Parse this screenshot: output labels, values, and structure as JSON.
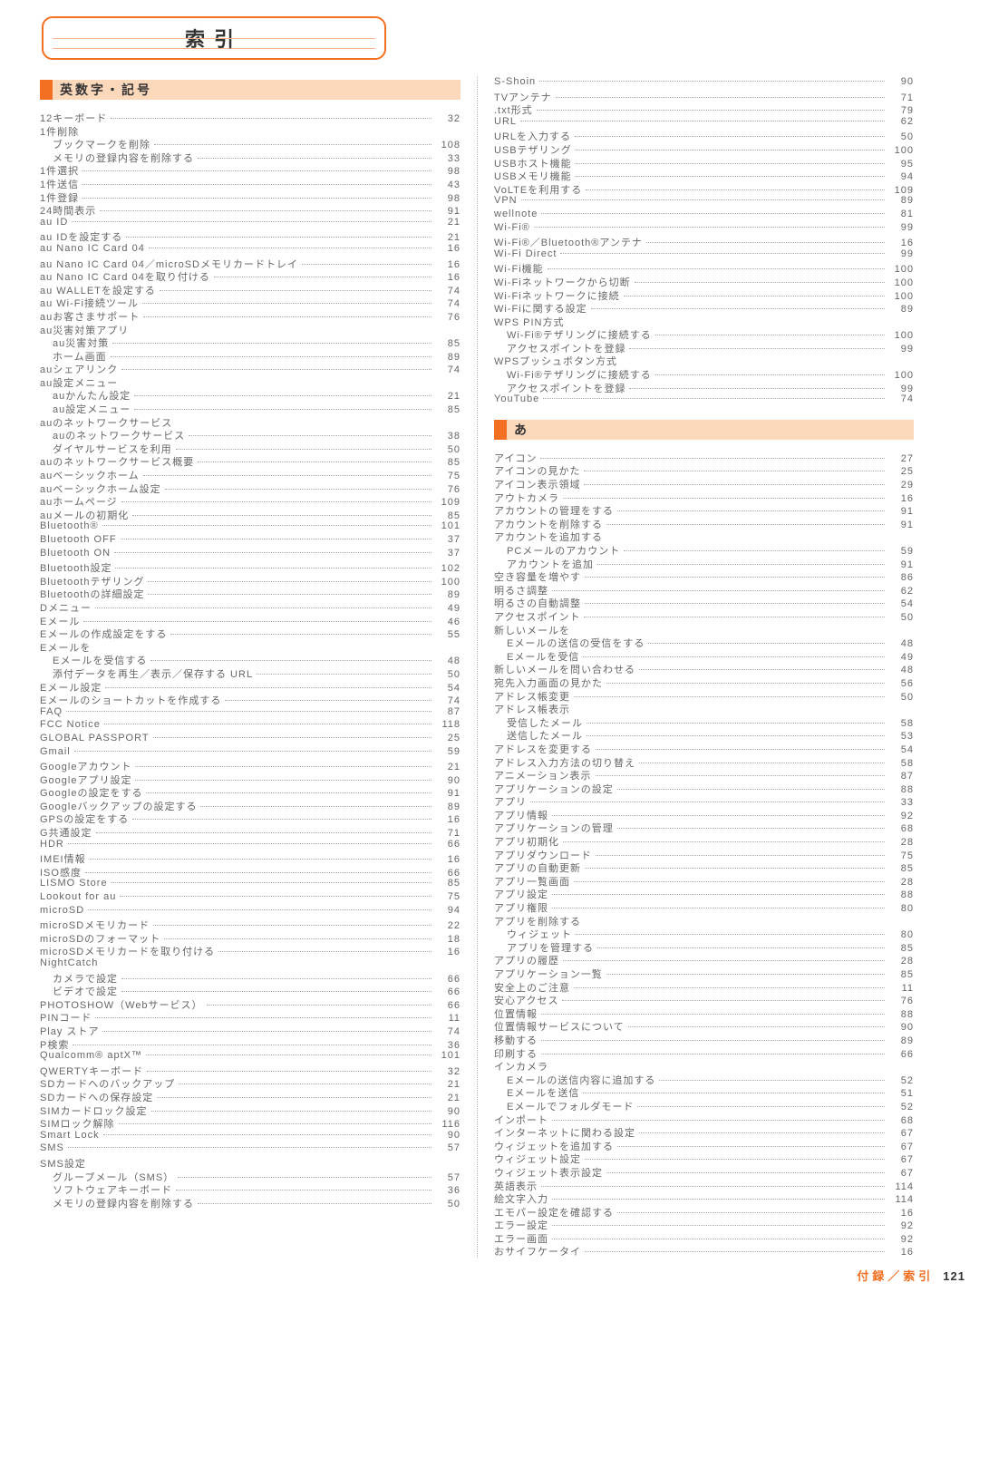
{
  "title": "索引",
  "sections": {
    "alpha": "英数字・記号",
    "kana": "あ"
  },
  "footer": {
    "label": "付録／索引",
    "page": "121"
  },
  "col1": [
    {
      "t": "12キーボード",
      "p": 32
    },
    {
      "t": "1件削除",
      "head": true
    },
    {
      "t": "ブックマークを削除",
      "p": 108,
      "i": 1
    },
    {
      "t": "メモリの登録内容を削除する",
      "p": 33,
      "i": 1
    },
    {
      "t": "1件選択",
      "p": 98
    },
    {
      "t": "1件送信",
      "p": 43
    },
    {
      "t": "1件登録",
      "p": 98
    },
    {
      "t": "24時間表示",
      "p": 91
    },
    {
      "t": "au ID",
      "p": 21
    },
    {
      "t": "au IDを設定する",
      "p": 21
    },
    {
      "t": "au Nano IC Card 04",
      "p": 16
    },
    {
      "t": "au Nano IC Card 04／microSDメモリカードトレイ",
      "p": 16
    },
    {
      "t": "au Nano IC Card 04を取り付ける",
      "p": 16
    },
    {
      "t": "au WALLETを設定する",
      "p": 74
    },
    {
      "t": "au Wi-Fi接続ツール",
      "p": 74
    },
    {
      "t": "auお客さまサポート",
      "p": 76
    },
    {
      "t": "au災害対策アプリ",
      "head": true
    },
    {
      "t": "au災害対策",
      "p": 85,
      "i": 1
    },
    {
      "t": "ホーム画面",
      "p": 89,
      "i": 1
    },
    {
      "t": "auシェアリンク",
      "p": 74
    },
    {
      "t": "au設定メニュー",
      "head": true
    },
    {
      "t": "auかんたん設定",
      "p": 21,
      "i": 1
    },
    {
      "t": "au設定メニュー",
      "p": 85,
      "i": 1
    },
    {
      "t": "auのネットワークサービス",
      "head": true
    },
    {
      "t": "auのネットワークサービス",
      "p": 38,
      "i": 1
    },
    {
      "t": "ダイヤルサービスを利用",
      "p": 50,
      "i": 1
    },
    {
      "t": "auのネットワークサービス概要",
      "p": 85
    },
    {
      "t": "auベーシックホーム",
      "p": 75
    },
    {
      "t": "auベーシックホーム設定",
      "p": 76
    },
    {
      "t": "auホームページ",
      "p": 109
    },
    {
      "t": "auメールの初期化",
      "p": 85
    },
    {
      "t": "Bluetooth®",
      "p": 101
    },
    {
      "t": "Bluetooth OFF",
      "p": 37
    },
    {
      "t": "Bluetooth ON",
      "p": 37
    },
    {
      "t": "Bluetooth設定",
      "p": 102
    },
    {
      "t": "Bluetoothテザリング",
      "p": 100
    },
    {
      "t": "Bluetoothの詳細設定",
      "p": 89
    },
    {
      "t": "Dメニュー",
      "p": 49
    },
    {
      "t": "Eメール",
      "p": 46
    },
    {
      "t": "Eメールの作成設定をする",
      "p": 55
    },
    {
      "t": "Eメールを",
      "head": true
    },
    {
      "t": "Eメールを受信する",
      "p": 48,
      "i": 1
    },
    {
      "t": "添付データを再生／表示／保存する URL",
      "p": 50,
      "i": 1
    },
    {
      "t": "Eメール設定",
      "p": 54
    },
    {
      "t": "Eメールのショートカットを作成する",
      "p": 74
    },
    {
      "t": "FAQ",
      "p": 87
    },
    {
      "t": "FCC Notice",
      "p": 118
    },
    {
      "t": "GLOBAL PASSPORT",
      "p": 25
    },
    {
      "t": "Gmail",
      "p": 59
    },
    {
      "t": "Googleアカウント",
      "p": 21
    },
    {
      "t": "Googleアプリ設定",
      "p": 90
    },
    {
      "t": "Googleの設定をする",
      "p": 91
    },
    {
      "t": "Googleバックアップの設定する",
      "p": 89
    },
    {
      "t": "GPSの設定をする",
      "p": 16
    },
    {
      "t": "G共通設定",
      "p": 71
    },
    {
      "t": "HDR",
      "p": 66
    },
    {
      "t": "IMEI情報",
      "p": 16
    },
    {
      "t": "ISO感度",
      "p": 66
    },
    {
      "t": "LISMO Store",
      "p": 85
    },
    {
      "t": "Lookout for au",
      "p": 75
    },
    {
      "t": "microSD",
      "p": 94
    },
    {
      "t": "microSDメモリカード",
      "p": 22
    },
    {
      "t": "microSDのフォーマット",
      "p": 18
    },
    {
      "t": "microSDメモリカードを取り付ける",
      "p": 16
    },
    {
      "t": "NightCatch",
      "head": true
    },
    {
      "t": "カメラで設定",
      "p": 66,
      "i": 1
    },
    {
      "t": "ビデオで設定",
      "p": 66,
      "i": 1
    },
    {
      "t": "PHOTOSHOW（Webサービス）",
      "p": 66
    },
    {
      "t": "PINコード",
      "p": 11
    },
    {
      "t": "Play ストア",
      "p": 74
    },
    {
      "t": "P検索",
      "p": 36
    },
    {
      "t": "Qualcomm® aptX™",
      "p": 101
    },
    {
      "t": "QWERTYキーボード",
      "p": 32
    },
    {
      "t": "SDカードへのバックアップ",
      "p": 21
    },
    {
      "t": "SDカードへの保存設定",
      "p": 21
    },
    {
      "t": "SIMカードロック設定",
      "p": 90
    },
    {
      "t": "SIMロック解除",
      "p": 116
    },
    {
      "t": "Smart Lock",
      "p": 90
    },
    {
      "t": "SMS",
      "p": 57
    },
    {
      "t": "SMS設定",
      "head": true
    },
    {
      "t": "グループメール（SMS）",
      "p": 57,
      "i": 1
    },
    {
      "t": "ソフトウェアキーボード",
      "p": 36,
      "i": 1
    },
    {
      "t": "メモリの登録内容を削除する",
      "p": 50,
      "i": 1
    }
  ],
  "col2a": [
    {
      "t": "S-Shoin",
      "p": 90
    },
    {
      "t": "TVアンテナ",
      "p": 71
    },
    {
      "t": ".txt形式",
      "p": 79
    },
    {
      "t": "URL",
      "p": 62
    },
    {
      "t": "URLを入力する",
      "p": 50
    },
    {
      "t": "USBテザリング",
      "p": 100
    },
    {
      "t": "USBホスト機能",
      "p": 95
    },
    {
      "t": "USBメモリ機能",
      "p": 94
    },
    {
      "t": "VoLTEを利用する",
      "p": 109
    },
    {
      "t": "VPN",
      "p": 89
    },
    {
      "t": "wellnote",
      "p": 81
    },
    {
      "t": "Wi-Fi®",
      "p": 99
    },
    {
      "t": "Wi-Fi®／Bluetooth®アンテナ",
      "p": 16
    },
    {
      "t": "Wi-Fi Direct",
      "p": 99
    },
    {
      "t": "Wi-Fi機能",
      "p": 100
    },
    {
      "t": "Wi-Fiネットワークから切断",
      "p": 100
    },
    {
      "t": "Wi-Fiネットワークに接続",
      "p": 100
    },
    {
      "t": "Wi-Fiに関する設定",
      "p": 89
    },
    {
      "t": "WPS PIN方式",
      "head": true
    },
    {
      "t": "Wi-Fi®テザリングに接続する",
      "p": 100,
      "i": 1
    },
    {
      "t": "アクセスポイントを登録",
      "p": 99,
      "i": 1
    },
    {
      "t": "WPSプッシュボタン方式",
      "head": true
    },
    {
      "t": "Wi-Fi®テザリングに接続する",
      "p": 100,
      "i": 1
    },
    {
      "t": "アクセスポイントを登録",
      "p": 99,
      "i": 1
    },
    {
      "t": "YouTube",
      "p": 74
    }
  ],
  "col2b": [
    {
      "t": "アイコン",
      "p": 27
    },
    {
      "t": "アイコンの見かた",
      "p": 25
    },
    {
      "t": "アイコン表示領域",
      "p": 29
    },
    {
      "t": "アウトカメラ",
      "p": 16
    },
    {
      "t": "アカウントの管理をする",
      "p": 91
    },
    {
      "t": "アカウントを削除する",
      "p": 91
    },
    {
      "t": "アカウントを追加する",
      "head": true
    },
    {
      "t": "PCメールのアカウント",
      "p": 59,
      "i": 1
    },
    {
      "t": "アカウントを追加",
      "p": 91,
      "i": 1
    },
    {
      "t": "空き容量を増やす",
      "p": 86
    },
    {
      "t": "明るさ調整",
      "p": 62
    },
    {
      "t": "明るさの自動調整",
      "p": 54
    },
    {
      "t": "アクセスポイント",
      "p": 50
    },
    {
      "t": "新しいメールを",
      "head": true
    },
    {
      "t": "Eメールの送信の受信をする",
      "p": 48,
      "i": 1
    },
    {
      "t": "Eメールを受信",
      "p": 49,
      "i": 1
    },
    {
      "t": "新しいメールを問い合わせる",
      "p": 48
    },
    {
      "t": "宛先入力画面の見かた",
      "p": 56
    },
    {
      "t": "アドレス帳変更",
      "p": 50
    },
    {
      "t": "アドレス帳表示",
      "head": true
    },
    {
      "t": "受信したメール",
      "p": 58,
      "i": 1
    },
    {
      "t": "送信したメール",
      "p": 53,
      "i": 1
    },
    {
      "t": "アドレスを変更する",
      "p": 54
    },
    {
      "t": "アドレス入力方法の切り替え",
      "p": 58
    },
    {
      "t": "アニメーション表示",
      "p": 87
    },
    {
      "t": "アプリケーションの設定",
      "p": 88
    },
    {
      "t": "アプリ",
      "p": 33
    },
    {
      "t": "アプリ情報",
      "p": 92
    },
    {
      "t": "アプリケーションの管理",
      "p": 68
    },
    {
      "t": "アプリ初期化",
      "p": 28
    },
    {
      "t": "アプリダウンロード",
      "p": 75
    },
    {
      "t": "アプリの自動更新",
      "p": 85
    },
    {
      "t": "アプリ一覧画面",
      "p": 28
    },
    {
      "t": "アプリ設定",
      "p": 88
    },
    {
      "t": "アプリ権限",
      "p": 80
    },
    {
      "t": "アプリを削除する",
      "head": true
    },
    {
      "t": "ウィジェット",
      "p": 80,
      "i": 1
    },
    {
      "t": "アプリを管理する",
      "p": 85,
      "i": 1
    },
    {
      "t": "アプリの履歴",
      "p": 28
    },
    {
      "t": "アプリケーション一覧",
      "p": 85
    },
    {
      "t": "安全上のご注意",
      "p": 11
    },
    {
      "t": "安心アクセス",
      "p": 76
    },
    {
      "t": "位置情報",
      "p": 88
    },
    {
      "t": "位置情報サービスについて",
      "p": 90
    },
    {
      "t": "移動する",
      "p": 89
    },
    {
      "t": "印刷する",
      "p": 66
    },
    {
      "t": "インカメラ",
      "head": true
    },
    {
      "t": "Eメールの送信内容に追加する",
      "p": 52,
      "i": 1
    },
    {
      "t": "Eメールを送信",
      "p": 51,
      "i": 1
    },
    {
      "t": "Eメールでフォルダモード",
      "p": 52,
      "i": 1
    },
    {
      "t": "インポート",
      "p": 68
    },
    {
      "t": "インターネットに関わる設定",
      "p": 67
    },
    {
      "t": "ウィジェットを追加する",
      "p": 67
    },
    {
      "t": "ウィジェット設定",
      "p": 67
    },
    {
      "t": "ウィジェット表示設定",
      "p": 67
    },
    {
      "t": "英語表示",
      "p": 114
    },
    {
      "t": "絵文字入力",
      "p": 114
    },
    {
      "t": "エモパー設定を確認する",
      "p": 16
    },
    {
      "t": "エラー設定",
      "p": 92
    },
    {
      "t": "エラー画面",
      "p": 92
    },
    {
      "t": "おサイフケータイ",
      "p": 16
    }
  ]
}
